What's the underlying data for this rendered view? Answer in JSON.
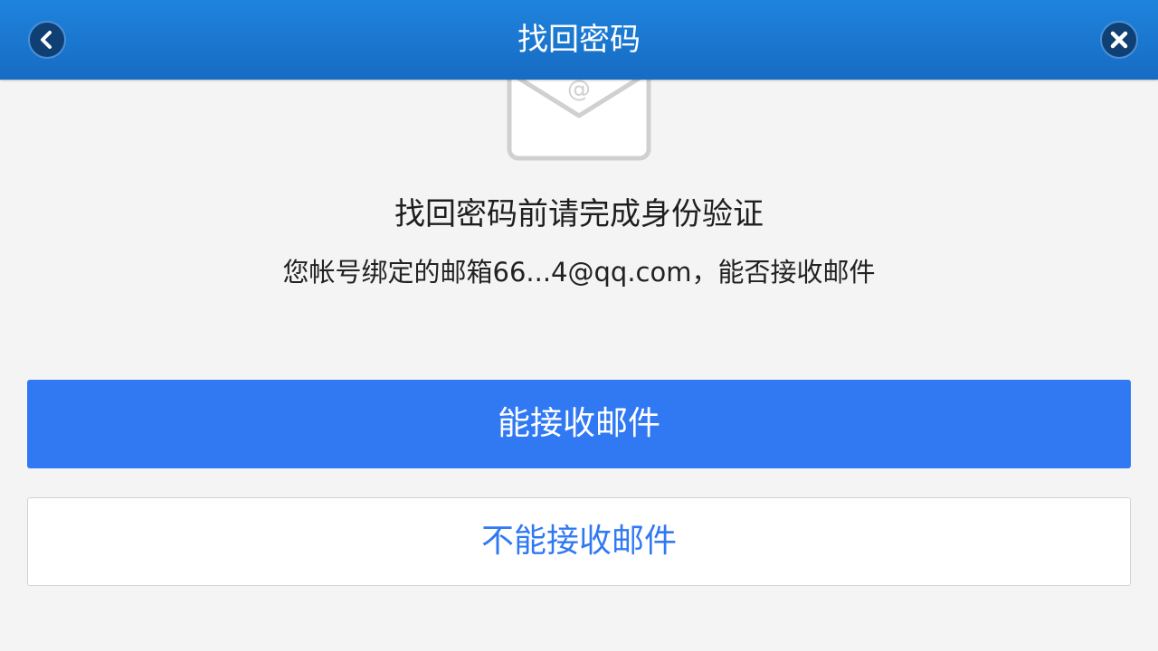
{
  "header": {
    "title": "找回密码",
    "back_icon": "chevron-left-icon",
    "close_icon": "close-icon"
  },
  "main": {
    "icon": "mail-envelope-icon",
    "icon_symbol": "@",
    "heading": "找回密码前请完成身份验证",
    "description": "您帐号绑定的邮箱66...4@qq.com，能否接收邮件"
  },
  "actions": {
    "can_receive_label": "能接收邮件",
    "cannot_receive_label": "不能接收邮件"
  },
  "colors": {
    "header_bg": "#1b76cf",
    "primary": "#3079f3",
    "background": "#f4f4f4"
  }
}
